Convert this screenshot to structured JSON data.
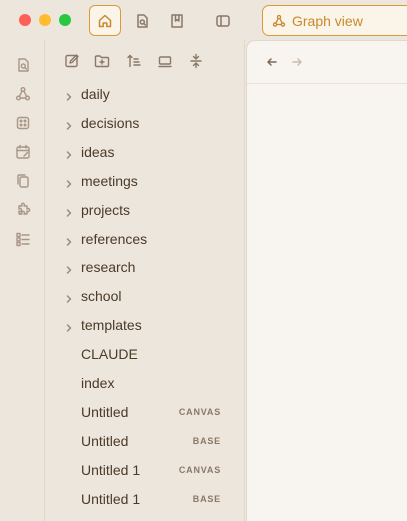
{
  "window": {
    "controls": [
      "close",
      "minimize",
      "zoom"
    ]
  },
  "toolbar": {
    "buttons": [
      {
        "icon": "home-icon",
        "active": true
      },
      {
        "icon": "file-search-icon",
        "active": false
      },
      {
        "icon": "bookmark-icon",
        "active": false
      },
      {
        "icon": "sidebar-toggle-icon",
        "active": false
      }
    ],
    "accent": "#c8892d"
  },
  "tab": {
    "label": "Graph view",
    "icon": "graph-icon"
  },
  "ribbon": {
    "icons": [
      "file-search-icon",
      "graph-icon",
      "grid-icon",
      "calendar-edit-icon",
      "copy-icon",
      "puzzle-icon",
      "checklist-icon"
    ]
  },
  "file_explorer": {
    "toolbar_icons": [
      "new-note-icon",
      "new-folder-icon",
      "sort-icon",
      "collapse-icon",
      "expand-all-icon"
    ],
    "items": [
      {
        "label": "daily",
        "type": "folder",
        "badge": ""
      },
      {
        "label": "decisions",
        "type": "folder",
        "badge": ""
      },
      {
        "label": "ideas",
        "type": "folder",
        "badge": ""
      },
      {
        "label": "meetings",
        "type": "folder",
        "badge": ""
      },
      {
        "label": "projects",
        "type": "folder",
        "badge": ""
      },
      {
        "label": "references",
        "type": "folder",
        "badge": ""
      },
      {
        "label": "research",
        "type": "folder",
        "badge": ""
      },
      {
        "label": "school",
        "type": "folder",
        "badge": ""
      },
      {
        "label": "templates",
        "type": "folder",
        "badge": ""
      },
      {
        "label": "CLAUDE",
        "type": "file",
        "badge": ""
      },
      {
        "label": "index",
        "type": "file",
        "badge": ""
      },
      {
        "label": "Untitled",
        "type": "file",
        "badge": "CANVAS"
      },
      {
        "label": "Untitled",
        "type": "file",
        "badge": "BASE"
      },
      {
        "label": "Untitled 1",
        "type": "file",
        "badge": "CANVAS"
      },
      {
        "label": "Untitled 1",
        "type": "file",
        "badge": "BASE"
      }
    ]
  },
  "main": {
    "nav": [
      "back",
      "forward"
    ]
  }
}
